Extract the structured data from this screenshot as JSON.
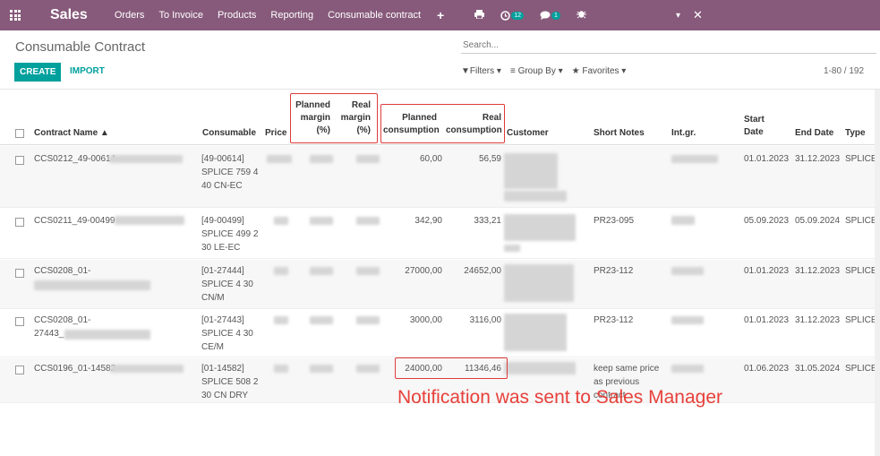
{
  "navbar": {
    "brand": "Sales",
    "menu": [
      "Orders",
      "To Invoice",
      "Products",
      "Reporting",
      "Consumable contract"
    ],
    "plus": "+",
    "activity_count": "12",
    "message_count": "1",
    "close": "✕",
    "dropdown": "▾"
  },
  "control": {
    "breadcrumb": "Consumable Contract",
    "search_placeholder": "Search...",
    "create": "CREATE",
    "import": "IMPORT",
    "filters": "Filters",
    "group_by": "Group By",
    "favorites": "Favorites",
    "pager": "1-80 / 192"
  },
  "columns": {
    "contract_name": "Contract Name ▲",
    "consumable": "Consumable",
    "price": "Price",
    "planned_margin_l1": "Planned",
    "planned_margin_l2": "margin",
    "planned_margin_l3": "(%)",
    "real_margin_l1": "Real",
    "real_margin_l2": "margin",
    "real_margin_l3": "(%)",
    "planned_cons_l1": "Planned",
    "planned_cons_l2": "consumption",
    "real_cons_l1": "Real",
    "real_cons_l2": "consumption",
    "customer": "Customer",
    "short_notes": "Short Notes",
    "int_gr": "Int.gr.",
    "start_date_l1": "Start",
    "start_date_l2": "Date",
    "end_date": "End Date",
    "type": "Type"
  },
  "rows": [
    {
      "name_l1": "CCS0212_49-00614",
      "name_l2": "",
      "cons_l1": "[49-00614]",
      "cons_l2": "SPLICE 759 4",
      "cons_l3": "40 CN-EC",
      "planned": "60,00",
      "real": "56,59",
      "notes_l1": "",
      "notes_l2": "",
      "notes_l3": "",
      "start": "01.01.2023",
      "end": "31.12.2023",
      "type": "SPLICE"
    },
    {
      "name_l1": "CCS0211_49-00499",
      "name_l2": "",
      "cons_l1": "[49-00499]",
      "cons_l2": "SPLICE 499 2",
      "cons_l3": "30 LE-EC",
      "planned": "342,90",
      "real": "333,21",
      "notes_l1": "PR23-095",
      "notes_l2": "",
      "notes_l3": "",
      "start": "05.09.2023",
      "end": "05.09.2024",
      "type": "SPLICE"
    },
    {
      "name_l1": "CCS0208_01-",
      "name_l2": "",
      "cons_l1": "[01-27444]",
      "cons_l2": "SPLICE 4 30",
      "cons_l3": "CN/M",
      "planned": "27000,00",
      "real": "24652,00",
      "notes_l1": "PR23-112",
      "notes_l2": "",
      "notes_l3": "",
      "start": "01.01.2023",
      "end": "31.12.2023",
      "type": "SPLICE"
    },
    {
      "name_l1": "CCS0208_01-",
      "name_l2": "27443_",
      "cons_l1": "[01-27443]",
      "cons_l2": "SPLICE 4 30",
      "cons_l3": "CE/M",
      "planned": "3000,00",
      "real": "3116,00",
      "notes_l1": "PR23-112",
      "notes_l2": "",
      "notes_l3": "",
      "start": "01.01.2023",
      "end": "31.12.2023",
      "type": "SPLICE"
    },
    {
      "name_l1": "CCS0196_01-14582",
      "name_l2": "",
      "cons_l1": "[01-14582]",
      "cons_l2": "SPLICE 508 2",
      "cons_l3": "30 CN DRY",
      "planned": "24000,00",
      "real": "11346,46",
      "notes_l1": "keep same price",
      "notes_l2": "as previous",
      "notes_l3": "contract",
      "start": "01.06.2023",
      "end": "31.05.2024",
      "type": "SPLICE"
    }
  ],
  "annotation": "Notification was sent to Sales Manager"
}
